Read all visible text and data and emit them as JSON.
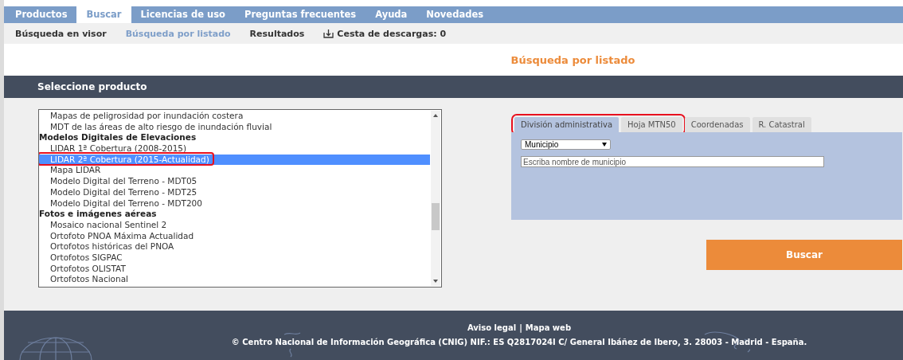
{
  "main_nav": [
    {
      "label": "Productos",
      "selected": false
    },
    {
      "label": "Buscar",
      "selected": true
    },
    {
      "label": "Licencias de uso",
      "selected": false
    },
    {
      "label": "Preguntas frecuentes",
      "selected": false
    },
    {
      "label": "Ayuda",
      "selected": false
    },
    {
      "label": "Novedades",
      "selected": false
    }
  ],
  "sub_nav": [
    {
      "label": "Búsqueda en visor",
      "selected": false
    },
    {
      "label": "Búsqueda por listado",
      "selected": true
    },
    {
      "label": "Resultados",
      "selected": false
    },
    {
      "label": "Cesta de descargas: 0",
      "selected": false,
      "kind": "basket"
    }
  ],
  "page_title": "Búsqueda por listado",
  "section_title": "Seleccione producto",
  "product_list": [
    {
      "label": "Mapas de peligrosidad por inundación costera",
      "kind": "option",
      "selected": false,
      "highlighted": false
    },
    {
      "label": "MDT de las áreas de alto riesgo de inundación fluvial",
      "kind": "option",
      "selected": false,
      "highlighted": false
    },
    {
      "label": "Modelos Digitales de Elevaciones",
      "kind": "group"
    },
    {
      "label": "LIDAR 1ª Cobertura (2008-2015)",
      "kind": "option",
      "selected": false,
      "highlighted": false
    },
    {
      "label": "LIDAR 2ª Cobertura (2015-Actualidad)",
      "kind": "option",
      "selected": true,
      "highlighted": true
    },
    {
      "label": "Mapa LIDAR",
      "kind": "option",
      "selected": false,
      "highlighted": false
    },
    {
      "label": "Modelo Digital del Terreno - MDT05",
      "kind": "option",
      "selected": false,
      "highlighted": false
    },
    {
      "label": "Modelo Digital del Terreno - MDT25",
      "kind": "option",
      "selected": false,
      "highlighted": false
    },
    {
      "label": "Modelo Digital del Terreno - MDT200",
      "kind": "option",
      "selected": false,
      "highlighted": false
    },
    {
      "label": "Fotos e imágenes aéreas",
      "kind": "group"
    },
    {
      "label": "Mosaico nacional Sentinel 2",
      "kind": "option",
      "selected": false,
      "highlighted": false
    },
    {
      "label": "Ortofoto PNOA Máxima Actualidad",
      "kind": "option",
      "selected": false,
      "highlighted": false
    },
    {
      "label": "Ortofotos históricas del PNOA",
      "kind": "option",
      "selected": false,
      "highlighted": false
    },
    {
      "label": "Ortofotos SIGPAC",
      "kind": "option",
      "selected": false,
      "highlighted": false
    },
    {
      "label": "Ortofotos OLISTAT",
      "kind": "option",
      "selected": false,
      "highlighted": false
    },
    {
      "label": "Ortofotos Nacional",
      "kind": "option",
      "selected": false,
      "highlighted": false
    }
  ],
  "search_tabs": [
    {
      "label": "División administrativa",
      "selected": true,
      "highlighted": true
    },
    {
      "label": "Hoja MTN50",
      "selected": false,
      "highlighted": true
    },
    {
      "label": "Coordenadas",
      "selected": false,
      "highlighted": false
    },
    {
      "label": "R. Catastral",
      "selected": false,
      "highlighted": false
    }
  ],
  "area_type_select": {
    "value": "Municipio"
  },
  "name_field": {
    "placeholder": "Escriba nombre de municipio"
  },
  "search_button": "Buscar",
  "footer": {
    "links": [
      "Aviso legal",
      "Mapa web"
    ],
    "separator": "|",
    "copyright": "© Centro Nacional de Información Geográfica (CNIG) NIF.: ES Q2817024I C/ General Ibáñez de Ibero, 3. 28003 - Madrid - España."
  }
}
